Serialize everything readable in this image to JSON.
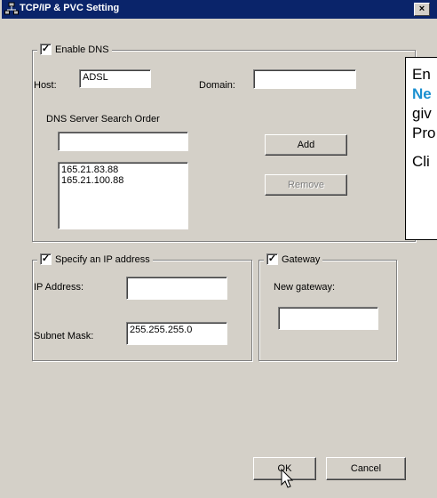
{
  "window": {
    "title": "TCP/IP & PVC Setting",
    "close_label": "×"
  },
  "dns": {
    "enable_label": "Enable DNS",
    "enabled": true,
    "host_label": "Host:",
    "host_value": "ADSL",
    "domain_label": "Domain:",
    "domain_value": "",
    "search_order_label": "DNS Server Search Order",
    "search_input_value": "",
    "servers": [
      "165.21.83.88",
      "165.21.100.88"
    ],
    "add_label": "Add",
    "remove_label": "Remove"
  },
  "ip": {
    "specify_label": "Specify an IP address",
    "enabled": true,
    "ip_label": "IP Address:",
    "ip_value": "",
    "mask_label": "Subnet Mask:",
    "mask_value": "255.255.255.0"
  },
  "gateway": {
    "label": "Gateway",
    "enabled": true,
    "new_label": "New gateway:",
    "new_value": ""
  },
  "buttons": {
    "ok_label": "OK",
    "cancel_label": "Cancel"
  },
  "callout": {
    "lines": [
      "En",
      "Ne",
      "giv",
      "Pro",
      "Cli"
    ]
  },
  "colors": {
    "titlebar": "#0a246a",
    "dialog": "#d4d0c8",
    "callout_keyword": "#1a8fd0"
  }
}
